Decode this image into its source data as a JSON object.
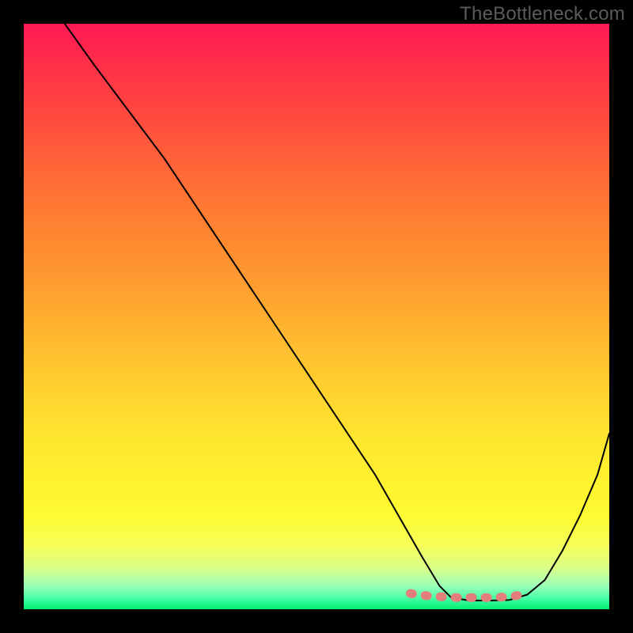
{
  "watermark": "TheBottleneck.com",
  "chart_data": {
    "type": "line",
    "title": "",
    "xlabel": "",
    "ylabel": "",
    "xlim": [
      0,
      100
    ],
    "ylim": [
      0,
      100
    ],
    "grid": false,
    "series": [
      {
        "name": "black-curve",
        "color": "#000000",
        "x": [
          7,
          12,
          18,
          24,
          30,
          36,
          42,
          48,
          54,
          60,
          64,
          68,
          71,
          73,
          76,
          80,
          83,
          86,
          89,
          92,
          95,
          98,
          100
        ],
        "y": [
          100,
          93,
          85,
          77,
          68,
          59,
          50,
          41,
          32,
          23,
          16,
          9,
          4,
          2,
          1.5,
          1.5,
          1.6,
          2.5,
          5,
          10,
          16,
          23,
          30
        ]
      },
      {
        "name": "pink-flat-segment",
        "color": "#e37f7b",
        "x": [
          66,
          68,
          70,
          72,
          74,
          76,
          78,
          80,
          82,
          84,
          85.5
        ],
        "y": [
          2.7,
          2.4,
          2.2,
          2.1,
          2.0,
          2.0,
          2.0,
          2.0,
          2.1,
          2.3,
          2.6
        ]
      }
    ],
    "annotations": []
  }
}
